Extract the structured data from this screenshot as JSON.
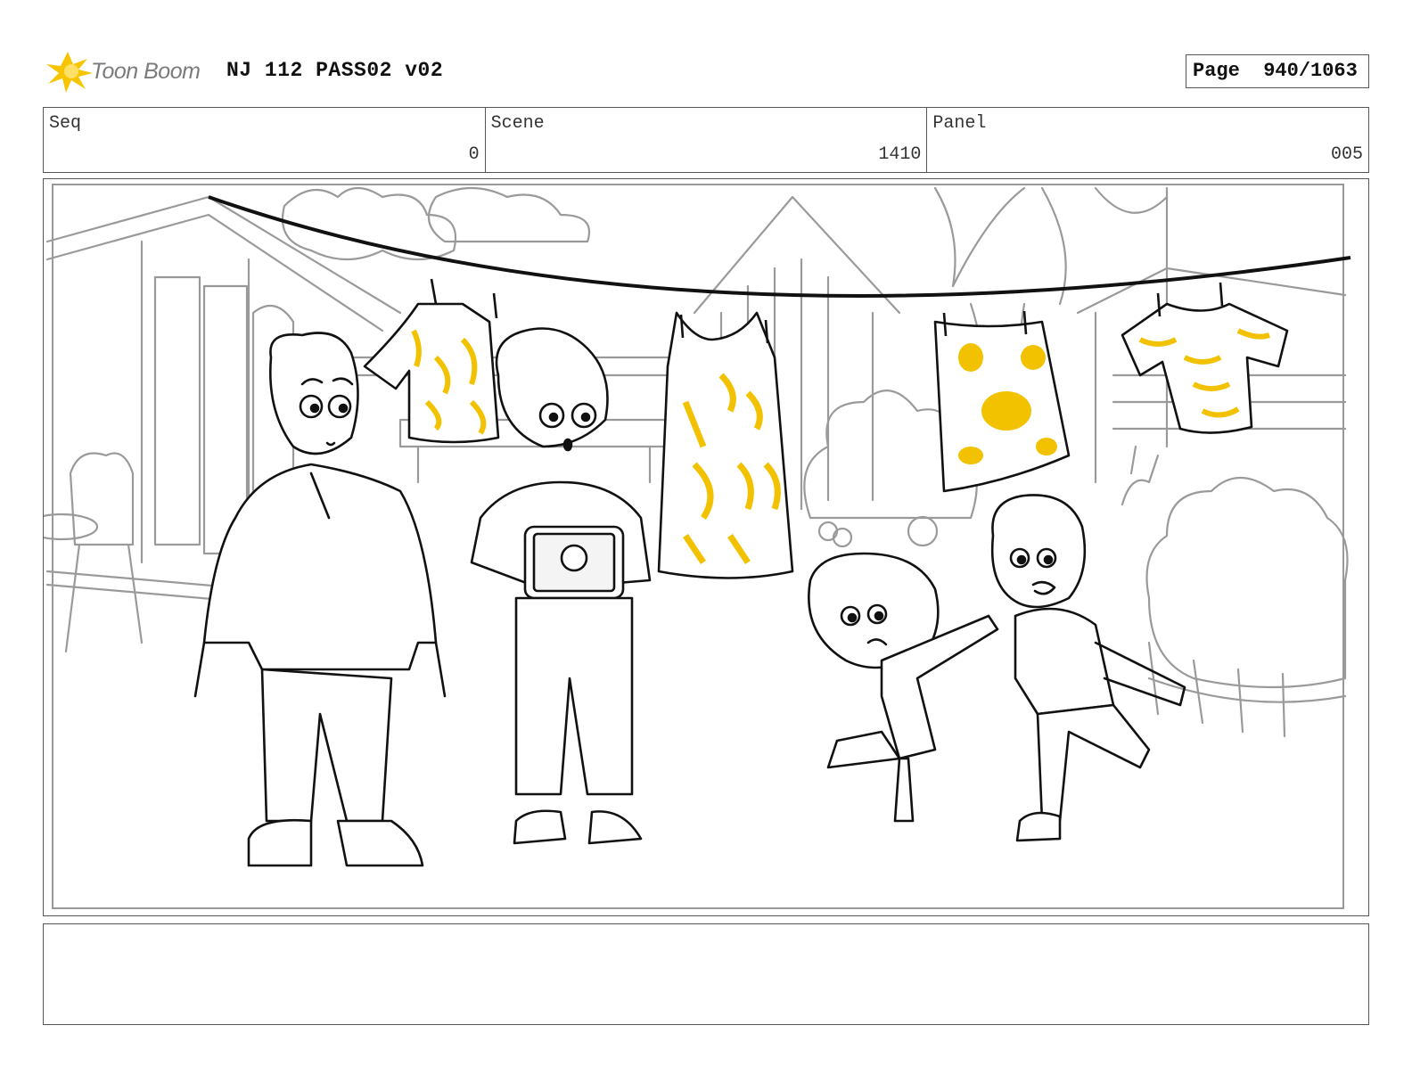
{
  "header": {
    "logo_text": "Toon Boom",
    "title": "NJ 112 PASS02 v02",
    "page_label": "Page",
    "page_value": "940/1063"
  },
  "info": {
    "seq": {
      "label": "Seq",
      "value": "0"
    },
    "scene": {
      "label": "Scene",
      "value": "1410"
    },
    "panel": {
      "label": "Panel",
      "value": "005"
    }
  },
  "colors": {
    "accent_yellow": "#f2c200",
    "sketch_line": "#111111",
    "background_line": "#9a9a9a",
    "frame_border": "#555555"
  },
  "icons": {
    "logo": "toon-boom-starburst-icon"
  },
  "notes": {
    "text": ""
  }
}
